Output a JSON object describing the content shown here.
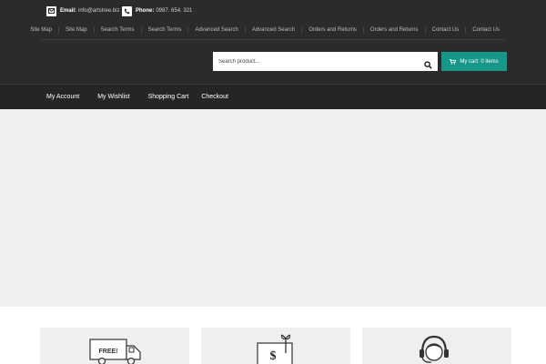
{
  "contact": {
    "email_label": "Email:",
    "email_value": "info@artstree.biz",
    "phone_label": "Phone:",
    "phone_value": "0987. 654. 321"
  },
  "top_links": [
    "Site Map",
    "Site Map",
    "Search Terms",
    "Search Terms",
    "Advanced Search",
    "Advanced Search",
    "Orders and Returns",
    "Orders and Returns",
    "Contact Us",
    "Contact Us"
  ],
  "search": {
    "placeholder": "Search product..."
  },
  "cart": {
    "label": "My cart: 0 items"
  },
  "nav": [
    "My Account",
    "My Wishlist",
    "Shopping Cart",
    "Checkout"
  ],
  "features": [
    {
      "icon": "delivery-truck-icon",
      "badge": "FREE!"
    },
    {
      "icon": "gift-card-icon",
      "symbol": "$"
    },
    {
      "icon": "support-headset-icon"
    }
  ],
  "colors": {
    "header_bg": "#2b2b2b",
    "nav_bg": "#252525",
    "accent": "#17968a",
    "banner_bg": "#efefef"
  }
}
